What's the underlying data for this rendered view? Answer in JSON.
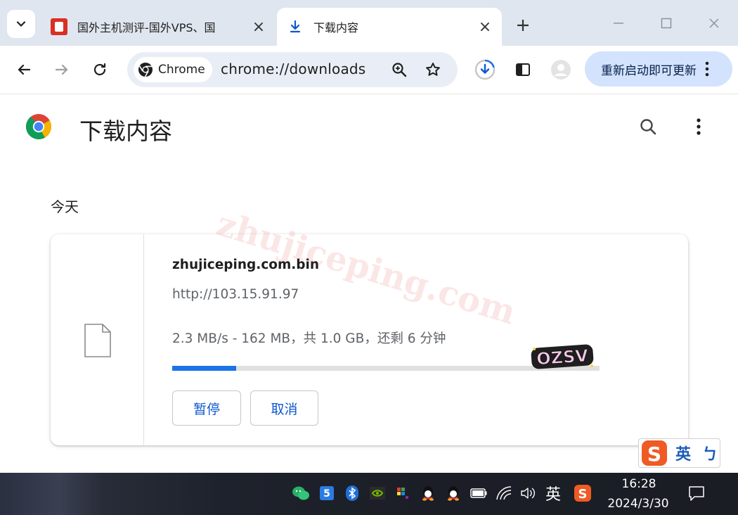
{
  "browser": {
    "tabs": [
      {
        "title": "国外主机测评-国外VPS、国",
        "active": false
      },
      {
        "title": "下载内容",
        "active": true
      }
    ],
    "omnibox": {
      "chip_label": "Chrome",
      "url": "chrome://downloads"
    },
    "update_button_label": "重新启动即可更新"
  },
  "page": {
    "title": "下载内容",
    "section_heading": "今天",
    "watermark": "zhujiceping.com"
  },
  "download": {
    "filename": "zhujiceping.com.bin",
    "source_url": "http://103.15.91.97",
    "status": "2.3 MB/s - 162 MB，共 1.0 GB，还剩 6 分钟",
    "progress_fraction": 0.15,
    "pause_label": "暂停",
    "cancel_label": "取消"
  },
  "overlays": {
    "ozsv_sticker": "OZSV",
    "ime_float_label": "英",
    "ime_float_extra": "ㄅ"
  },
  "taskbar": {
    "ime_indicator": "英",
    "time": "16:28",
    "date": "2024/3/30"
  },
  "colors": {
    "accent": "#1a73e8",
    "update_button_bg": "#d3e3fd",
    "watermark": "#e24a4a",
    "sogou": "#f05a24"
  }
}
